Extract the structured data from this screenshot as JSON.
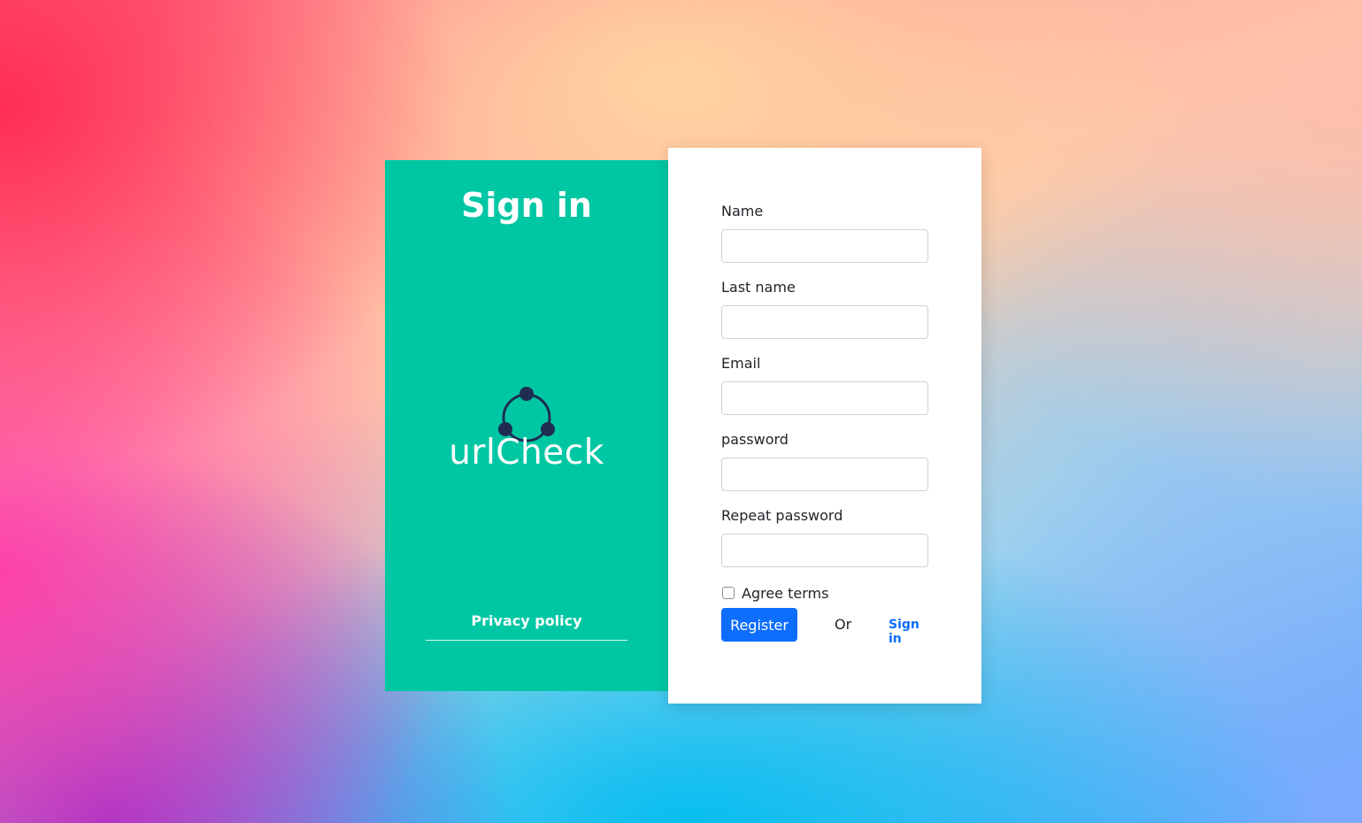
{
  "left_panel": {
    "title": "Sign in",
    "logo_text": "urlCheck",
    "privacy_link": "Privacy policy",
    "background_color": "#00c7a3",
    "logo_icon": "network-circle-icon",
    "logo_icon_color": "#1f2d52"
  },
  "form": {
    "fields": {
      "name": {
        "label": "Name",
        "value": ""
      },
      "last_name": {
        "label": "Last name",
        "value": ""
      },
      "email": {
        "label": "Email",
        "value": ""
      },
      "password": {
        "label": "password",
        "value": ""
      },
      "repeat_password": {
        "label": "Repeat password",
        "value": ""
      }
    },
    "agree_terms": {
      "label": "Agree terms",
      "checked": false
    },
    "register_button": "Register",
    "or_text": "Or",
    "sign_in_link": "Sign in",
    "accent_color": "#0d6efd"
  }
}
